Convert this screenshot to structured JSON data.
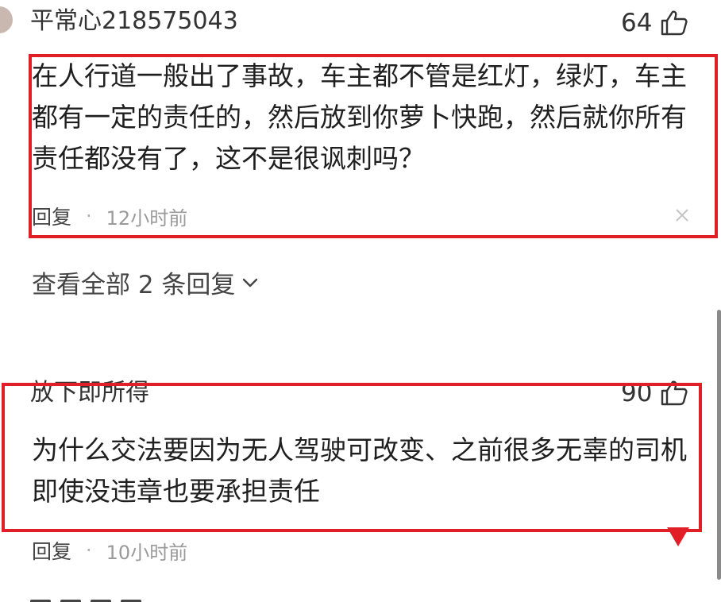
{
  "comments": [
    {
      "username": "平常心218575043",
      "likes": "64",
      "text_lines": [
        "在人行道一般出了事故，车主都不管是红灯，绿灯，车主",
        "都有一定的责任的，然后放到你萝卜快跑，然后就你所有",
        "责任都没有了，这不是很讽刺吗？"
      ],
      "reply_label": "回复",
      "separator": "·",
      "time": "12小时前"
    },
    {
      "username": "放下即所得",
      "likes": "90",
      "text_lines": [
        "为什么交法要因为无人驾驶可改变、之前很多无辜的司机",
        "即使没违章也要承担责任"
      ],
      "reply_label": "回复",
      "separator": "·",
      "time": "10小时前"
    }
  ],
  "view_replies": "查看全部 2 条回复",
  "icons": {
    "like": "thumbs-up-icon",
    "close": "close-icon",
    "expand": "chevron-down-icon"
  },
  "colors": {
    "highlight_box": "#e11f26",
    "text": "#222222",
    "meta": "#9a9a9a"
  }
}
